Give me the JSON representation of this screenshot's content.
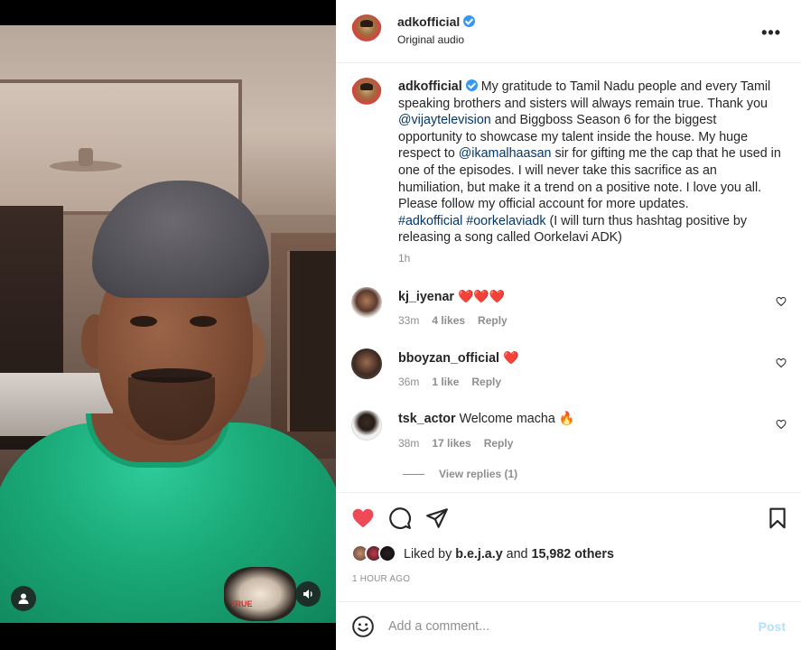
{
  "post": {
    "username": "adkofficial",
    "audio": "Original audio",
    "more_label": "•••"
  },
  "caption": {
    "username": "adkofficial",
    "part1": " My gratitude to Tamil Nadu people and every Tamil speaking brothers and sisters will always remain true. Thank you ",
    "mention1": "@vijaytelevision",
    "part2": " and Biggboss Season 6 for the biggest opportunity to showcase my talent inside the house. My huge respect to ",
    "mention2": "@ikamalhaasan",
    "part3": " sir for gifting me the cap that he used in one of the episodes. I will never take this sacrifice as an humiliation, but make it a trend on a positive note. I love you all. Please follow my official account for more updates.",
    "hashtag1": "#adkofficial",
    "hashtag2": "#oorkelaviadk",
    "part4": " (I will turn thus hashtag positive by releasing a song called Oorkelavi ADK)",
    "time": "1h"
  },
  "comments": [
    {
      "username": "kj_iyenar",
      "text": "❤️❤️❤️",
      "time": "33m",
      "likes": "4 likes",
      "reply": "Reply"
    },
    {
      "username": "bboyzan_official",
      "text": "❤️",
      "time": "36m",
      "likes": "1 like",
      "reply": "Reply"
    },
    {
      "username": "tsk_actor",
      "text": "Welcome macha 🔥",
      "time": "38m",
      "likes": "17 likes",
      "reply": "Reply"
    }
  ],
  "view_replies": "View replies (1)",
  "likes": {
    "prefix": "Liked by ",
    "user": "b.e.j.a.y",
    "middle": " and ",
    "count": "15,982 others"
  },
  "posted_ago": "1 HOUR AGO",
  "add_comment": {
    "placeholder": "Add a comment...",
    "post_label": "Post"
  },
  "video_logo_text": "TRUE",
  "colors": {
    "liked_heart": "#ed4956",
    "link": "#00376b",
    "verified": "#3897f0"
  }
}
